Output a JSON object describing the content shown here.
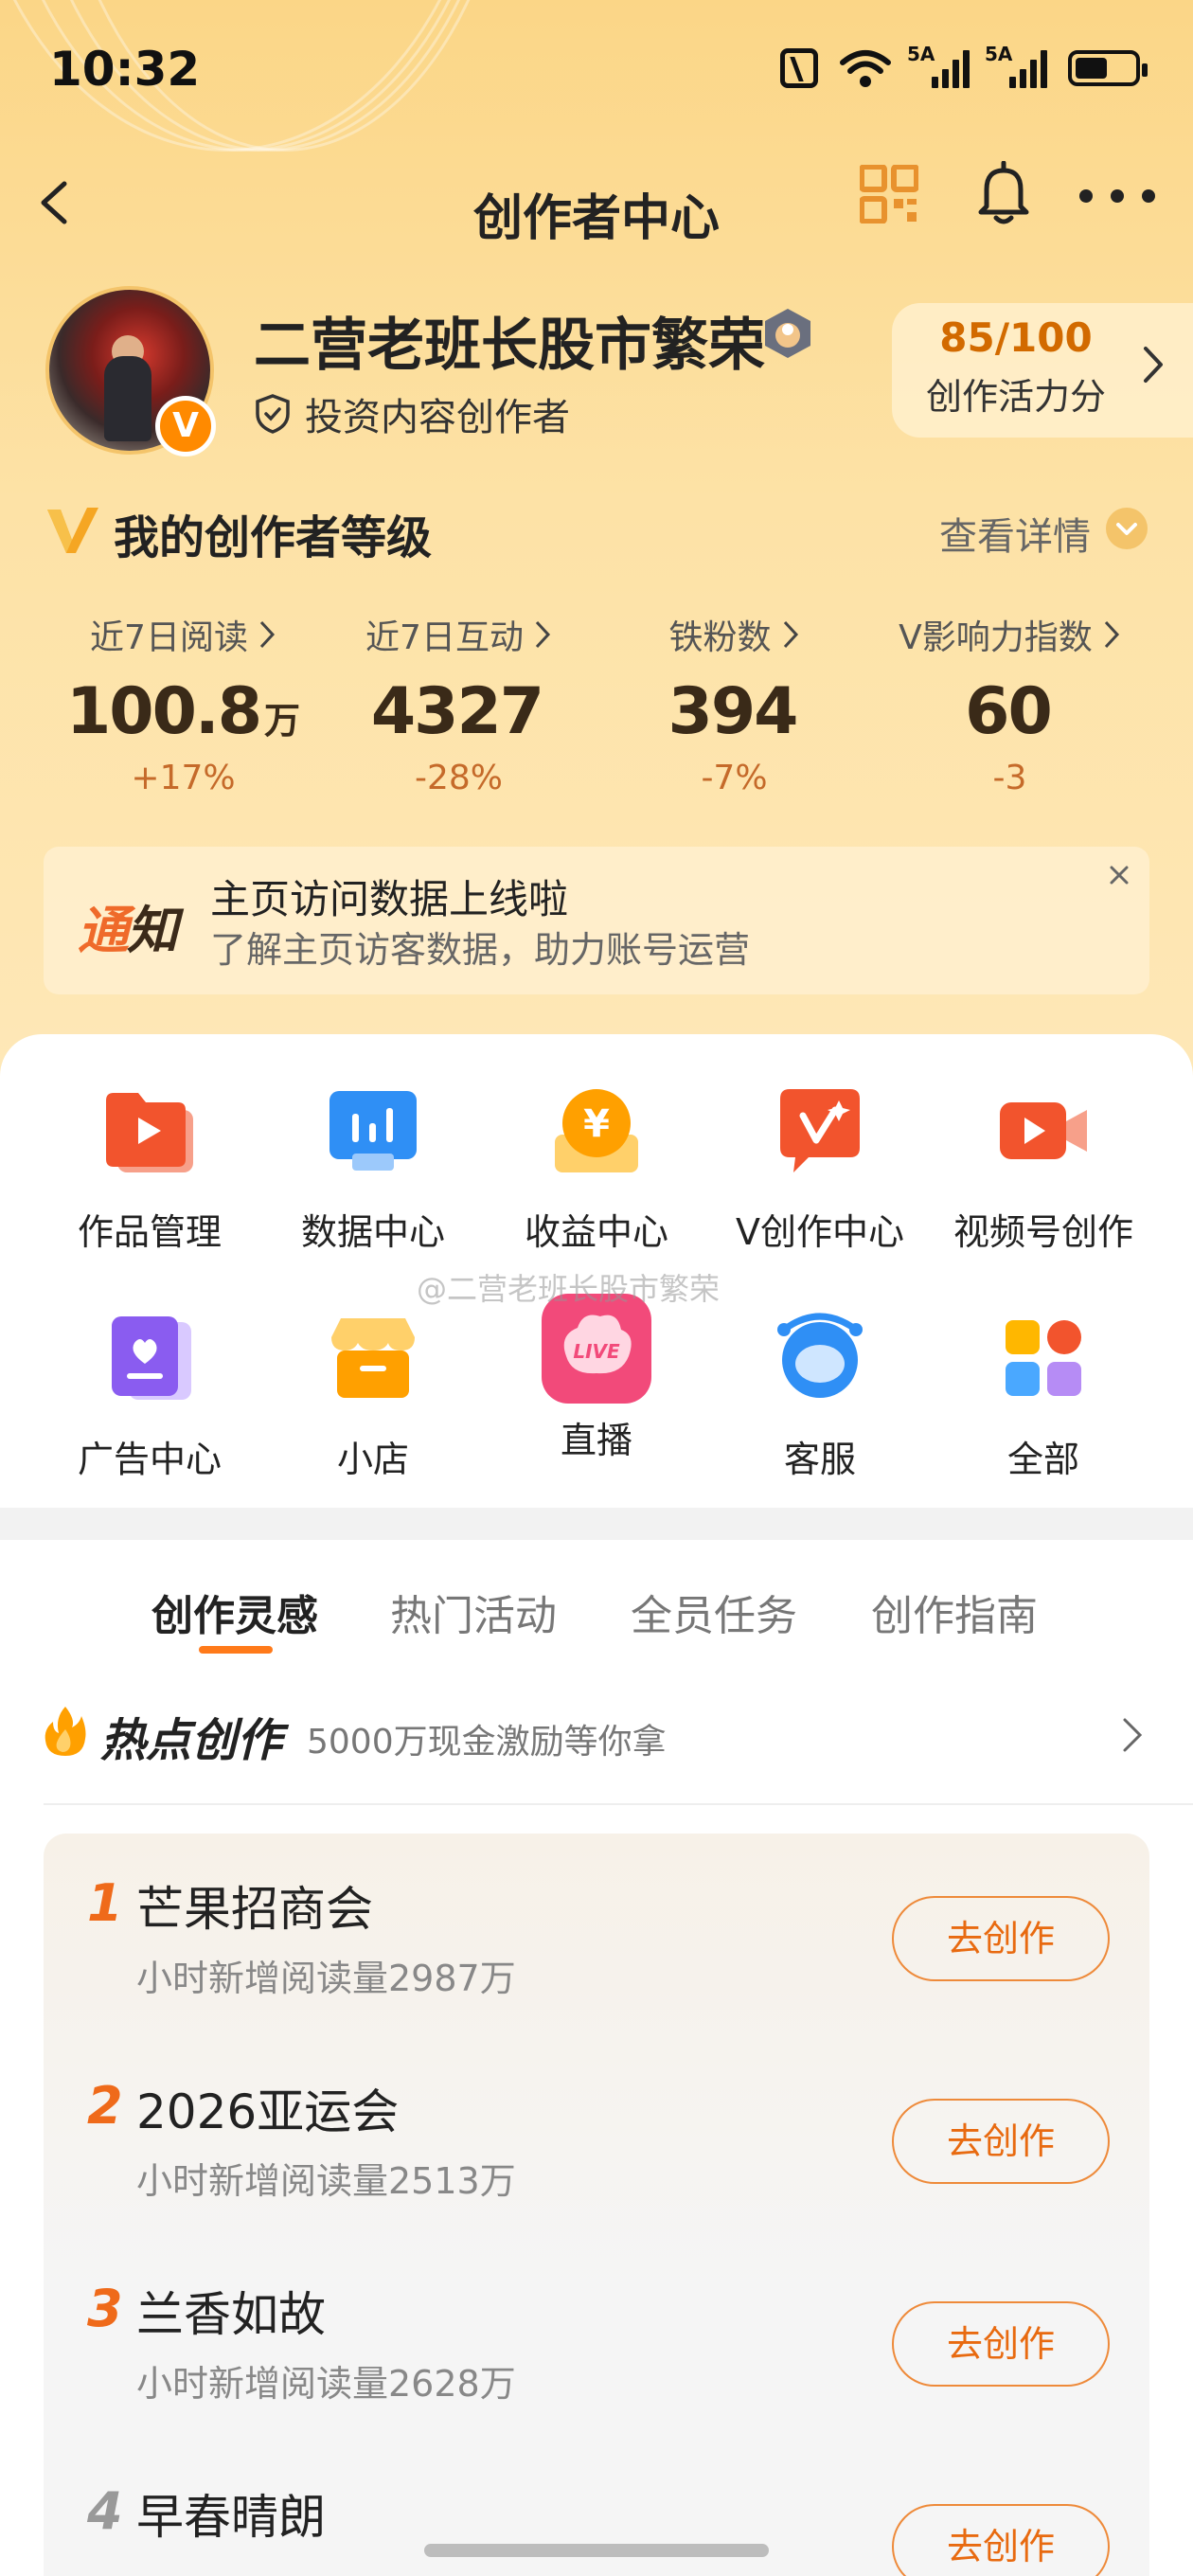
{
  "status_bar": {
    "time": "10:32",
    "signal1_tag": "5A",
    "signal2_tag": "5A",
    "battery_level": 0.55
  },
  "nav": {
    "title": "创作者中心",
    "back_icon": "chevron-left-icon",
    "qr_icon": "qr-code-icon",
    "bell_icon": "bell-icon",
    "more_icon": "more-dots-icon"
  },
  "profile": {
    "username": "二营老班长股市繁荣",
    "badge_letter": "V",
    "creator_label": "投资内容创作者",
    "vitality_score": "85/100",
    "vitality_label": "创作活力分"
  },
  "level": {
    "title": "我的创作者等级",
    "detail_label": "查看详情"
  },
  "stats": [
    {
      "label": "近7日阅读",
      "value": "100.8",
      "unit": "万",
      "change": "+17%"
    },
    {
      "label": "近7日互动",
      "value": "4327",
      "unit": "",
      "change": "-28%"
    },
    {
      "label": "铁粉数",
      "value": "394",
      "unit": "",
      "change": "-7%"
    },
    {
      "label": "V影响力指数",
      "value": "60",
      "unit": "",
      "change": "-3"
    }
  ],
  "notice": {
    "tag_part1": "通",
    "tag_part2": "知",
    "title": "主页访问数据上线啦",
    "subtitle": "了解主页访客数据，助力账号运营"
  },
  "grid": [
    {
      "label": "作品管理",
      "icon": "works-management-icon",
      "color": "#f2542d"
    },
    {
      "label": "数据中心",
      "icon": "data-center-icon",
      "color": "#2f8ff5"
    },
    {
      "label": "收益中心",
      "icon": "income-center-icon",
      "color": "#ffa000"
    },
    {
      "label": "V创作中心",
      "icon": "v-creation-icon",
      "color": "#f2542d"
    },
    {
      "label": "视频号创作",
      "icon": "video-creation-icon",
      "color": "#f2542d"
    },
    {
      "label": "广告中心",
      "icon": "ad-center-icon",
      "color": "#8a5cf0"
    },
    {
      "label": "小店",
      "icon": "shop-icon",
      "color": "#ffa000"
    },
    {
      "label": "直播",
      "icon": "live-icon",
      "color": "#f24a7a"
    },
    {
      "label": "客服",
      "icon": "customer-service-icon",
      "color": "#2f8ff5"
    },
    {
      "label": "全部",
      "icon": "all-apps-icon",
      "color": "#ffb700"
    }
  ],
  "live_icon_text": "LIVE",
  "watermark": "@二营老班长股市繁荣",
  "tabs": [
    {
      "label": "创作灵感",
      "active": true
    },
    {
      "label": "热门活动",
      "active": false
    },
    {
      "label": "全员任务",
      "active": false
    },
    {
      "label": "创作指南",
      "active": false
    }
  ],
  "hot": {
    "title": "热点创作",
    "subtitle": "5000万现金激励等你拿"
  },
  "hot_items": [
    {
      "rank": "1",
      "title": "芒果招商会",
      "sub": "小时新增阅读量2987万",
      "button": "去创作"
    },
    {
      "rank": "2",
      "title": "2026亚运会",
      "sub": "小时新增阅读量2513万",
      "button": "去创作"
    },
    {
      "rank": "3",
      "title": "兰香如故",
      "sub": "小时新增阅读量2628万",
      "button": "去创作"
    },
    {
      "rank": "4",
      "title": "早春晴朗",
      "sub": "",
      "button": "去创作"
    }
  ]
}
